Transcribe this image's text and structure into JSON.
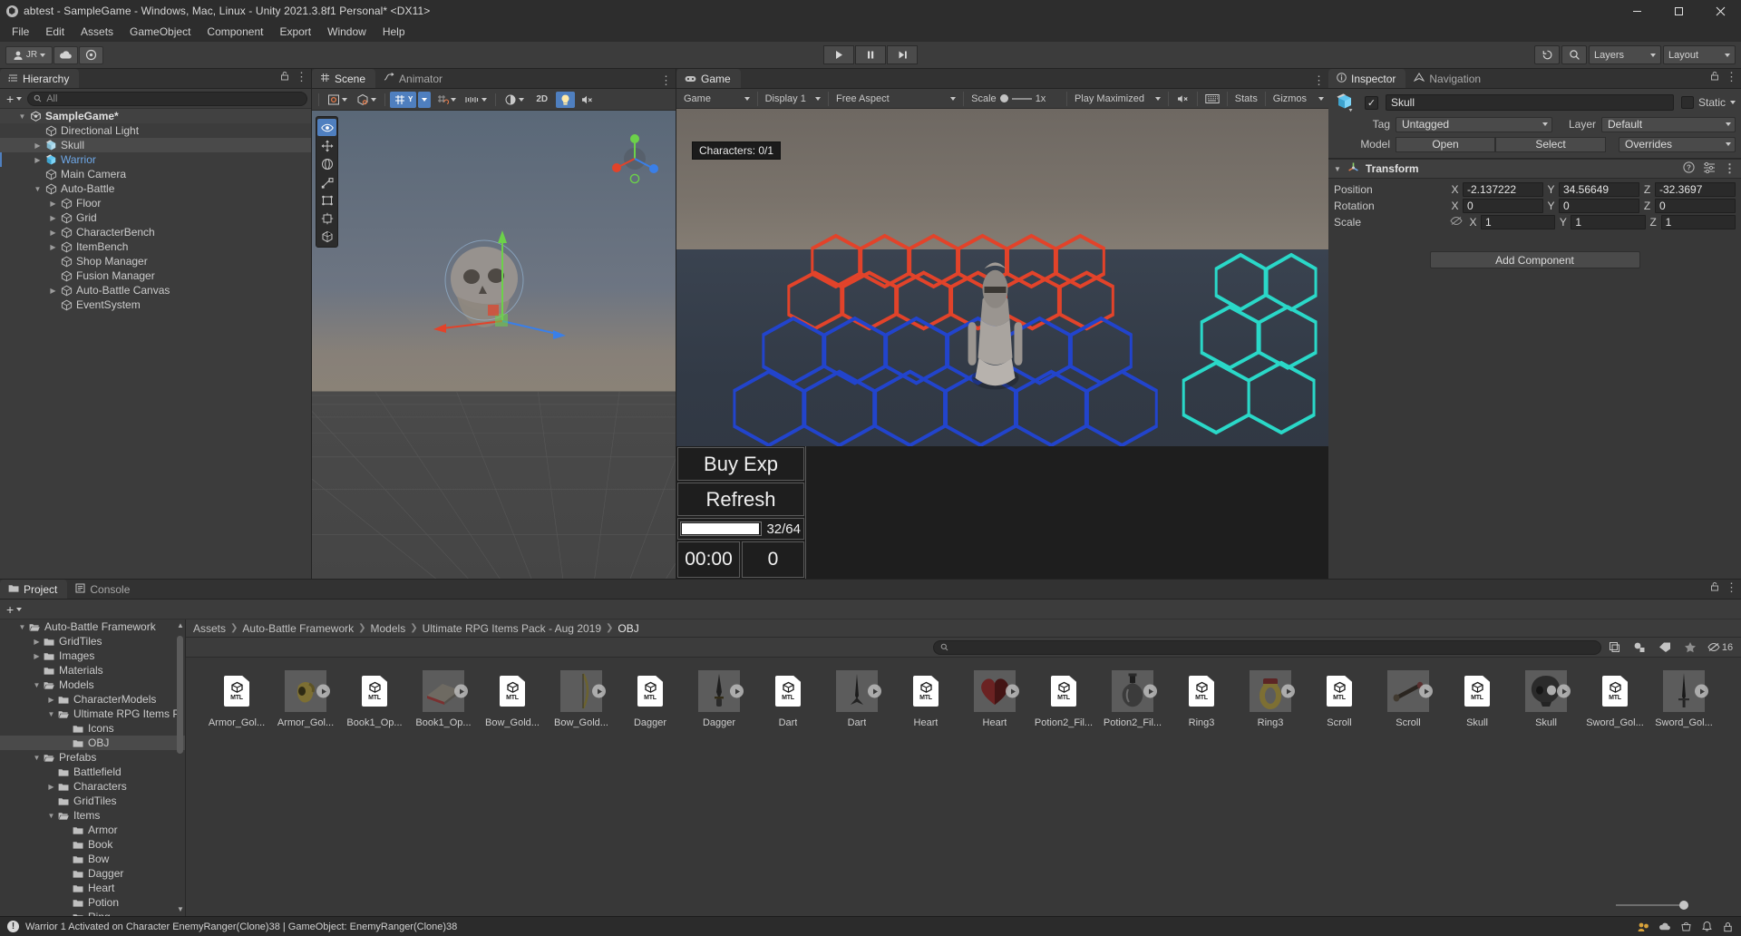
{
  "window": {
    "title": "abtest - SampleGame - Windows, Mac, Linux - Unity 2021.3.8f1 Personal* <DX11>",
    "minimize": "–",
    "maximize": "▢",
    "close": "✕"
  },
  "menubar": {
    "items": [
      "File",
      "Edit",
      "Assets",
      "GameObject",
      "Component",
      "Export",
      "Window",
      "Help"
    ]
  },
  "toolbar": {
    "account_label": "JR",
    "cloud_label": "cloud-icon",
    "collab_label": "collab-icon",
    "play": "▶",
    "pause": "❚❚",
    "step": "▶❙",
    "undo_history": "↺",
    "search": "🔍",
    "layers_label": "Layers",
    "layout_label": "Layout"
  },
  "hierarchy": {
    "tab": "Hierarchy",
    "search_placeholder": "All",
    "add_label": "+",
    "items": [
      {
        "label": "SampleGame*",
        "depth": 0,
        "icon": "scene-icon",
        "expander": "down",
        "bold": true,
        "selected": false,
        "alt": true
      },
      {
        "label": "Directional Light",
        "depth": 1,
        "icon": "gameobject-icon",
        "expander": "none",
        "bold": false,
        "selected": false,
        "alt": false
      },
      {
        "label": "Skull",
        "depth": 1,
        "icon": "prefab-icon",
        "expander": "right",
        "bold": false,
        "selected": true,
        "alt": false
      },
      {
        "label": "Warrior",
        "depth": 1,
        "icon": "prefab-blue-icon",
        "expander": "right",
        "bold": false,
        "selected": false,
        "alt": false,
        "blue": true,
        "marker": true
      },
      {
        "label": "Main Camera",
        "depth": 1,
        "icon": "gameobject-icon",
        "expander": "none",
        "bold": false,
        "selected": false,
        "alt": false
      },
      {
        "label": "Auto-Battle",
        "depth": 1,
        "icon": "gameobject-icon",
        "expander": "down",
        "bold": false,
        "selected": false,
        "alt": false
      },
      {
        "label": "Floor",
        "depth": 2,
        "icon": "gameobject-icon",
        "expander": "right",
        "bold": false,
        "selected": false,
        "alt": false
      },
      {
        "label": "Grid",
        "depth": 2,
        "icon": "gameobject-icon",
        "expander": "right",
        "bold": false,
        "selected": false,
        "alt": false
      },
      {
        "label": "CharacterBench",
        "depth": 2,
        "icon": "gameobject-icon",
        "expander": "right",
        "bold": false,
        "selected": false,
        "alt": false
      },
      {
        "label": "ItemBench",
        "depth": 2,
        "icon": "gameobject-icon",
        "expander": "right",
        "bold": false,
        "selected": false,
        "alt": false
      },
      {
        "label": "Shop Manager",
        "depth": 2,
        "icon": "gameobject-icon",
        "expander": "none",
        "bold": false,
        "selected": false,
        "alt": false
      },
      {
        "label": "Fusion Manager",
        "depth": 2,
        "icon": "gameobject-icon",
        "expander": "none",
        "bold": false,
        "selected": false,
        "alt": false
      },
      {
        "label": "Auto-Battle Canvas",
        "depth": 2,
        "icon": "gameobject-icon",
        "expander": "right",
        "bold": false,
        "selected": false,
        "alt": false
      },
      {
        "label": "EventSystem",
        "depth": 2,
        "icon": "gameobject-icon",
        "expander": "none",
        "bold": false,
        "selected": false,
        "alt": false
      }
    ]
  },
  "scene": {
    "tabs": [
      {
        "label": "Scene",
        "icon": "grid-icon",
        "active": true
      },
      {
        "label": "Animator",
        "icon": "animator-icon",
        "active": false
      }
    ],
    "toolbar": {
      "shading_mode": "shaded-mode-icon",
      "draw_mode": "draw-mode-icon",
      "grid_visibility": "grid-icon",
      "grid_snap": "grid-snap-icon",
      "snap_increment": "snap-increment-icon",
      "skybox_toggle": "skybox-icon",
      "twod_label": "2D",
      "lighting_toggle": "lightbulb-icon",
      "audio_toggle": "audio-mute-icon"
    },
    "tools": [
      "view-tool",
      "move-tool",
      "rotate-tool",
      "scale-tool",
      "rect-tool",
      "transform-tool",
      "custom-tool"
    ],
    "gizmo_axes": [
      "x",
      "y",
      "z"
    ]
  },
  "game": {
    "tab": "Game",
    "toolbar": {
      "display_target": "Game",
      "display": "Display 1",
      "aspect": "Free Aspect",
      "scale_label": "Scale",
      "scale_value": "1x",
      "play_mode": "Play Maximized",
      "mute_audio": "mute-audio-icon",
      "vsync": "vsync-icon",
      "stats": "Stats",
      "gizmos": "Gizmos"
    },
    "overlay": {
      "characters_badge": "Characters: 0/1",
      "buy_exp": "Buy Exp",
      "refresh": "Refresh",
      "exp_value": "32/64",
      "timer": "00:00",
      "gold": "0"
    }
  },
  "inspector": {
    "tabs": [
      {
        "label": "Inspector",
        "icon": "info-icon",
        "active": true
      },
      {
        "label": "Navigation",
        "icon": "navigation-icon",
        "active": false
      }
    ],
    "object_name": "Skull",
    "enabled_check": "✓",
    "static_label": "Static",
    "tag_label": "Tag",
    "tag_value": "Untagged",
    "layer_label": "Layer",
    "layer_value": "Default",
    "model_label": "Model",
    "open_button": "Open",
    "select_button": "Select",
    "overrides_button": "Overrides",
    "component": {
      "title": "Transform",
      "help_icon": "help-icon",
      "preset_icon": "preset-icon",
      "menu_icon": "kebab-menu-icon",
      "rows": [
        {
          "name": "Position",
          "x": "-2.137222",
          "y": "34.56649",
          "z": "-32.3697",
          "eye": false
        },
        {
          "name": "Rotation",
          "x": "0",
          "y": "0",
          "z": "0",
          "eye": false
        },
        {
          "name": "Scale",
          "x": "1",
          "y": "1",
          "z": "1",
          "eye": true
        }
      ],
      "axis_labels": [
        "X",
        "Y",
        "Z"
      ]
    },
    "add_component": "Add Component"
  },
  "project": {
    "tabs": [
      {
        "label": "Project",
        "icon": "folder-icon",
        "active": true
      },
      {
        "label": "Console",
        "icon": "console-icon",
        "active": false
      }
    ],
    "add_label": "+",
    "tree": [
      {
        "label": "Auto-Battle Framework",
        "depth": 0,
        "expander": "down",
        "open": true,
        "selected": false
      },
      {
        "label": "GridTiles",
        "depth": 1,
        "expander": "right",
        "open": false,
        "selected": false
      },
      {
        "label": "Images",
        "depth": 1,
        "expander": "right",
        "open": false,
        "selected": false
      },
      {
        "label": "Materials",
        "depth": 1,
        "expander": "none",
        "open": false,
        "selected": false
      },
      {
        "label": "Models",
        "depth": 1,
        "expander": "down",
        "open": true,
        "selected": false
      },
      {
        "label": "CharacterModels",
        "depth": 2,
        "expander": "right",
        "open": false,
        "selected": false
      },
      {
        "label": "Ultimate RPG Items P",
        "depth": 2,
        "expander": "down",
        "open": true,
        "selected": false
      },
      {
        "label": "Icons",
        "depth": 3,
        "expander": "none",
        "open": false,
        "selected": false
      },
      {
        "label": "OBJ",
        "depth": 3,
        "expander": "none",
        "open": false,
        "selected": true
      },
      {
        "label": "Prefabs",
        "depth": 1,
        "expander": "down",
        "open": true,
        "selected": false
      },
      {
        "label": "Battlefield",
        "depth": 2,
        "expander": "none",
        "open": false,
        "selected": false
      },
      {
        "label": "Characters",
        "depth": 2,
        "expander": "right",
        "open": false,
        "selected": false
      },
      {
        "label": "GridTiles",
        "depth": 2,
        "expander": "none",
        "open": false,
        "selected": false
      },
      {
        "label": "Items",
        "depth": 2,
        "expander": "down",
        "open": true,
        "selected": false
      },
      {
        "label": "Armor",
        "depth": 3,
        "expander": "none",
        "open": false,
        "selected": false
      },
      {
        "label": "Book",
        "depth": 3,
        "expander": "none",
        "open": false,
        "selected": false
      },
      {
        "label": "Bow",
        "depth": 3,
        "expander": "none",
        "open": false,
        "selected": false
      },
      {
        "label": "Dagger",
        "depth": 3,
        "expander": "none",
        "open": false,
        "selected": false
      },
      {
        "label": "Heart",
        "depth": 3,
        "expander": "none",
        "open": false,
        "selected": false
      },
      {
        "label": "Potion",
        "depth": 3,
        "expander": "none",
        "open": false,
        "selected": false
      },
      {
        "label": "Ring",
        "depth": 3,
        "expander": "none",
        "open": false,
        "selected": false
      }
    ],
    "breadcrumb": [
      "Assets",
      "Auto-Battle Framework",
      "Models",
      "Ultimate RPG Items Pack - Aug 2019",
      "OBJ"
    ],
    "search_placeholder": "",
    "filter_icons": [
      "search-by-type-icon",
      "search-by-label-icon",
      "favorites-icon"
    ],
    "hidden_count": "16",
    "assets": [
      {
        "name": "Armor_Gol...",
        "kind": "mtl"
      },
      {
        "name": "Armor_Gol...",
        "kind": "obj",
        "shape": "armor"
      },
      {
        "name": "Book1_Op...",
        "kind": "mtl"
      },
      {
        "name": "Book1_Op...",
        "kind": "obj",
        "shape": "book"
      },
      {
        "name": "Bow_Gold...",
        "kind": "mtl"
      },
      {
        "name": "Bow_Gold...",
        "kind": "obj",
        "shape": "bow"
      },
      {
        "name": "Dagger",
        "kind": "mtl"
      },
      {
        "name": "Dagger",
        "kind": "obj",
        "shape": "dagger"
      },
      {
        "name": "Dart",
        "kind": "mtl"
      },
      {
        "name": "Dart",
        "kind": "obj",
        "shape": "dart"
      },
      {
        "name": "Heart",
        "kind": "mtl"
      },
      {
        "name": "Heart",
        "kind": "obj",
        "shape": "heart"
      },
      {
        "name": "Potion2_Fil...",
        "kind": "mtl"
      },
      {
        "name": "Potion2_Fil...",
        "kind": "obj",
        "shape": "potion"
      },
      {
        "name": "Ring3",
        "kind": "mtl"
      },
      {
        "name": "Ring3",
        "kind": "obj",
        "shape": "ring"
      },
      {
        "name": "Scroll",
        "kind": "mtl"
      },
      {
        "name": "Scroll",
        "kind": "obj",
        "shape": "scroll"
      },
      {
        "name": "Skull",
        "kind": "mtl"
      },
      {
        "name": "Skull",
        "kind": "obj",
        "shape": "skull"
      },
      {
        "name": "Sword_Gol...",
        "kind": "mtl"
      },
      {
        "name": "Sword_Gol...",
        "kind": "obj",
        "shape": "sword"
      }
    ]
  },
  "statusbar": {
    "message": "Warrior 1 Activated on Character EnemyRanger(Clone)38  |  GameObject: EnemyRanger(Clone)38",
    "right_icons": [
      "collab-icon",
      "cloud-icon",
      "asset-store-icon",
      "notification-icon",
      "lock-icon"
    ]
  },
  "colors": {
    "accent": "#4f7fbf",
    "panel": "#383838",
    "toolbar": "#3c3c3c",
    "selection_blue": "#6ea8e8",
    "red_team": "#e2432a",
    "blue_team": "#2244cc",
    "cyan_team": "#2ad8c8"
  }
}
